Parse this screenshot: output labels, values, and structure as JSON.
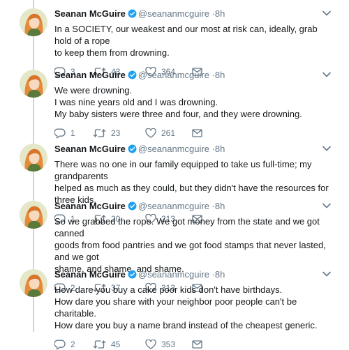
{
  "tweets": [
    {
      "author": "Seanan McGuire",
      "handle": "@seananmcguire",
      "time": "·8h",
      "text": "In a SOCIETY, our weakest and our most at risk can, ideally, grab hold of a rope\nto keep them from drowning.",
      "replies": "3",
      "retweets": "43",
      "likes": "364"
    },
    {
      "author": "Seanan McGuire",
      "handle": "@seananmcguire",
      "time": "·8h",
      "text": "We were drowning.\nI was nine years old and I was drowning.\nMy baby sisters were three and four, and they were drowning.",
      "replies": "1",
      "retweets": "23",
      "likes": "261"
    },
    {
      "author": "Seanan McGuire",
      "handle": "@seananmcguire",
      "time": "·8h",
      "text": "There was no one in our family equipped to take us full-time; my grandparents\nhelped as much as they could, but they didn't have the resources for three kids.",
      "replies": "1",
      "retweets": "20",
      "likes": "213"
    },
    {
      "author": "Seanan McGuire",
      "handle": "@seananmcguire",
      "time": "·8h",
      "text": "So we grabbed the rope. We got money from the state and we got canned\ngoods from food pantries and we got food stamps that never lasted, and we got\nshame, and shame, and shame.",
      "replies": "2",
      "retweets": "37",
      "likes": "313"
    },
    {
      "author": "Seanan McGuire",
      "handle": "@seananmcguire",
      "time": "·8h",
      "text": "How dare you buy a cake poor kids don't have birthdays.\nHow dare you share with your neighbor poor people can't be charitable.\nHow dare you buy a name brand instead of the cheapest generic.",
      "replies": "2",
      "retweets": "45",
      "likes": "353"
    }
  ],
  "icons": {
    "verified": "verified-badge-icon",
    "caret": "chevron-down-icon",
    "reply": "reply-icon",
    "retweet": "retweet-icon",
    "like": "heart-icon",
    "message": "envelope-icon"
  },
  "colors": {
    "verified": "#1da1f2",
    "muted": "#657786",
    "thread_line": "#ccd6dd"
  }
}
